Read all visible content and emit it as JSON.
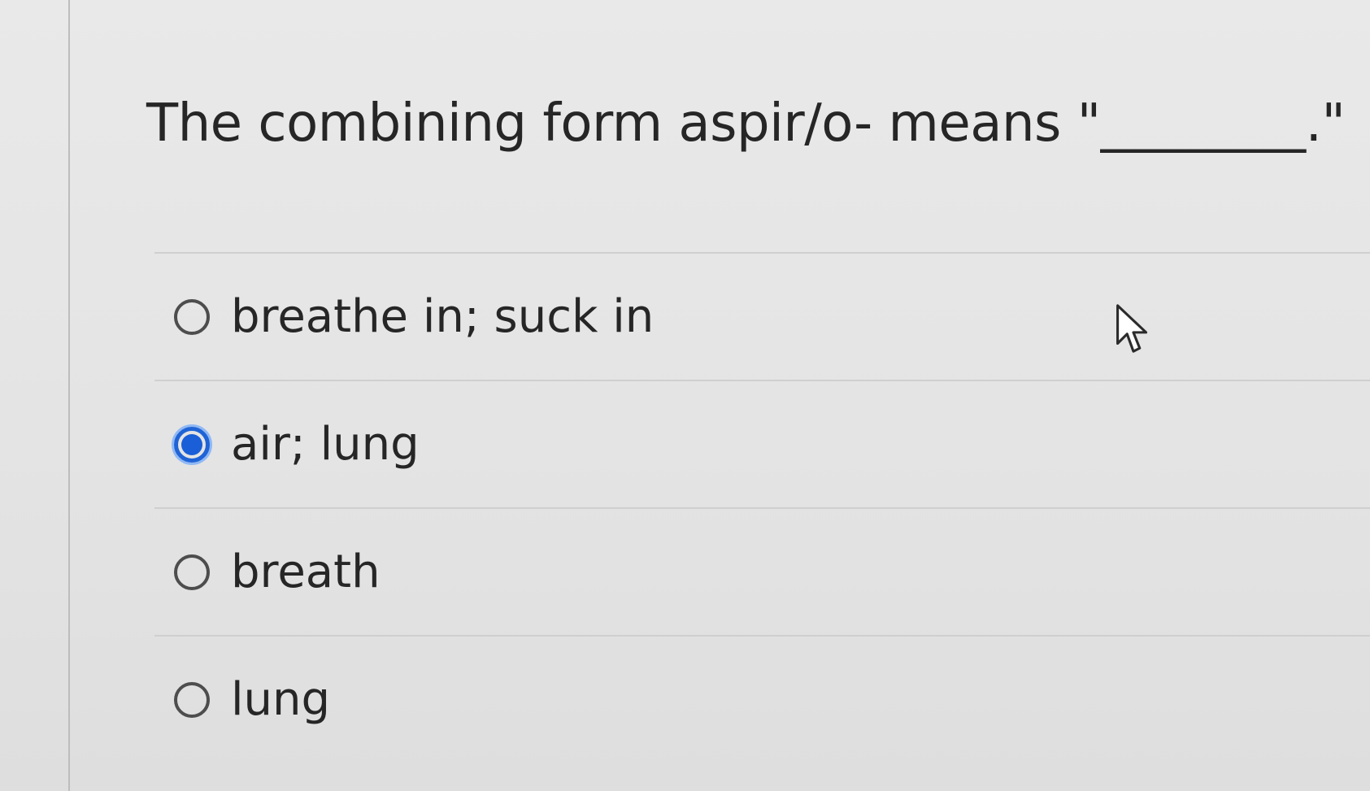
{
  "question": {
    "text": "The combining form aspir/o- means \"________.\""
  },
  "options": [
    {
      "label": "breathe in; suck in",
      "selected": false
    },
    {
      "label": "air; lung",
      "selected": true
    },
    {
      "label": "breath",
      "selected": false
    },
    {
      "label": "lung",
      "selected": false
    }
  ],
  "colors": {
    "selected_accent": "#1a5fd8",
    "text": "#262626",
    "divider": "#cfcfcf",
    "background": "#e6e6e6"
  },
  "icons": {
    "cursor": "mouse-pointer-icon"
  }
}
